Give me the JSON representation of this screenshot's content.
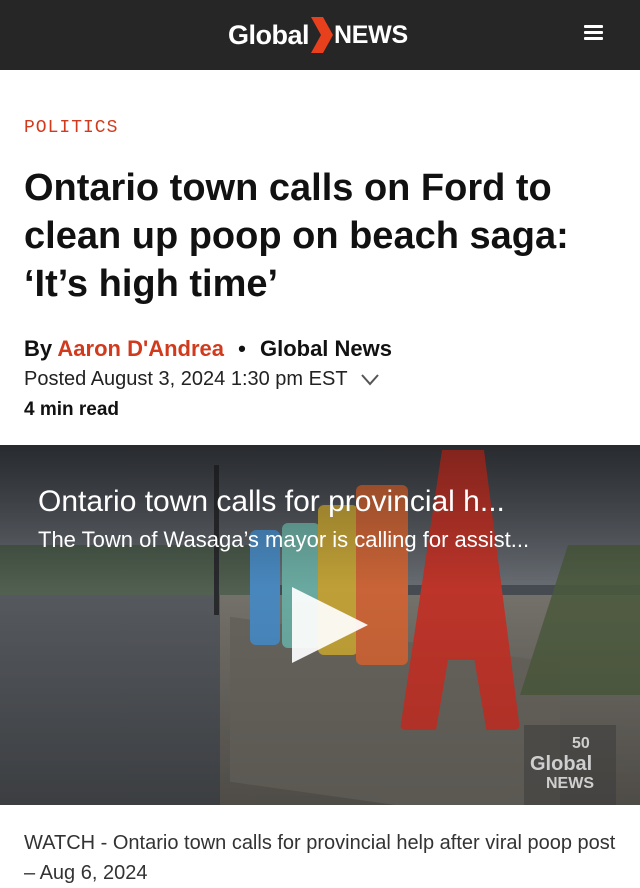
{
  "header": {
    "logo_left": "Global",
    "logo_right": "NEWS",
    "menu_icon": "hamburger-menu-icon",
    "brand_color": "#262626",
    "accent_color": "#d23a1d"
  },
  "article": {
    "category": "POLITICS",
    "headline": "Ontario town calls on Ford to clean up poop on beach saga: ‘It’s high time’",
    "byline_prefix": "By",
    "author": "Aaron D'Andrea",
    "separator": "•",
    "outlet": "Global News",
    "posted": "Posted August 3, 2024 1:30 pm EST",
    "read_time": "4 min read"
  },
  "video": {
    "title": "Ontario town calls for provincial h...",
    "description": "The Town of Wasaga’s mayor is calling for assist...",
    "play_icon": "play-icon",
    "watermark_number": "50",
    "watermark_top": "Global",
    "watermark_bottom": "NEWS"
  },
  "caption": "WATCH - Ontario town calls for provincial help after viral poop post – Aug 6, 2024"
}
